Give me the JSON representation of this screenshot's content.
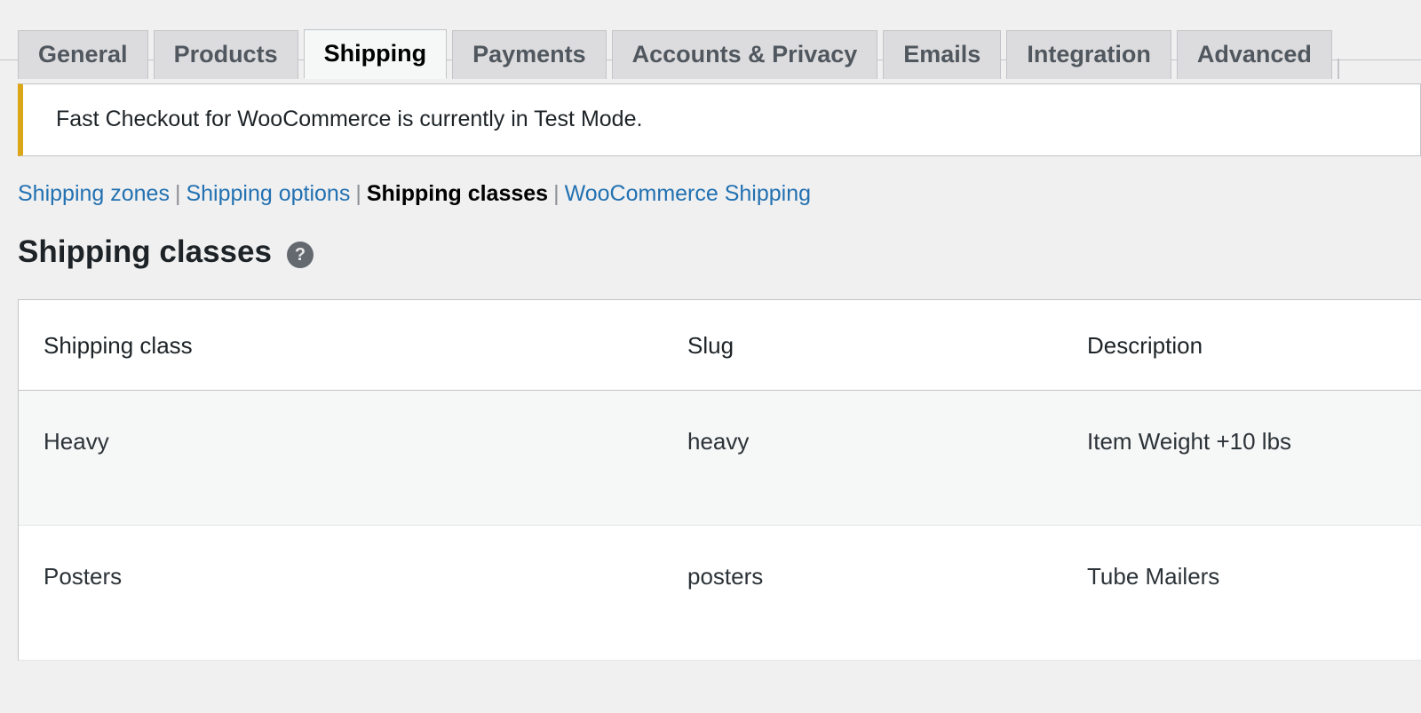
{
  "tabs": [
    {
      "label": "General",
      "active": false
    },
    {
      "label": "Products",
      "active": false
    },
    {
      "label": "Shipping",
      "active": true
    },
    {
      "label": "Payments",
      "active": false
    },
    {
      "label": "Accounts & Privacy",
      "active": false
    },
    {
      "label": "Emails",
      "active": false
    },
    {
      "label": "Integration",
      "active": false
    },
    {
      "label": "Advanced",
      "active": false
    }
  ],
  "notice": {
    "message": "Fast Checkout for WooCommerce is currently in Test Mode.",
    "accent_color": "#dba617"
  },
  "subnav": {
    "items": [
      {
        "label": "Shipping zones",
        "current": false
      },
      {
        "label": "Shipping options",
        "current": false
      },
      {
        "label": "Shipping classes",
        "current": true
      },
      {
        "label": "WooCommerce Shipping",
        "current": false
      }
    ],
    "separator": "|",
    "link_color": "#2271b1"
  },
  "heading": {
    "title": "Shipping classes",
    "help_icon": "help-icon",
    "help_glyph": "?"
  },
  "table": {
    "columns": [
      "Shipping class",
      "Slug",
      "Description"
    ],
    "rows": [
      {
        "name": "Heavy",
        "slug": "heavy",
        "description": "Item Weight +10 lbs"
      },
      {
        "name": "Posters",
        "slug": "posters",
        "description": "Tube Mailers"
      }
    ]
  }
}
